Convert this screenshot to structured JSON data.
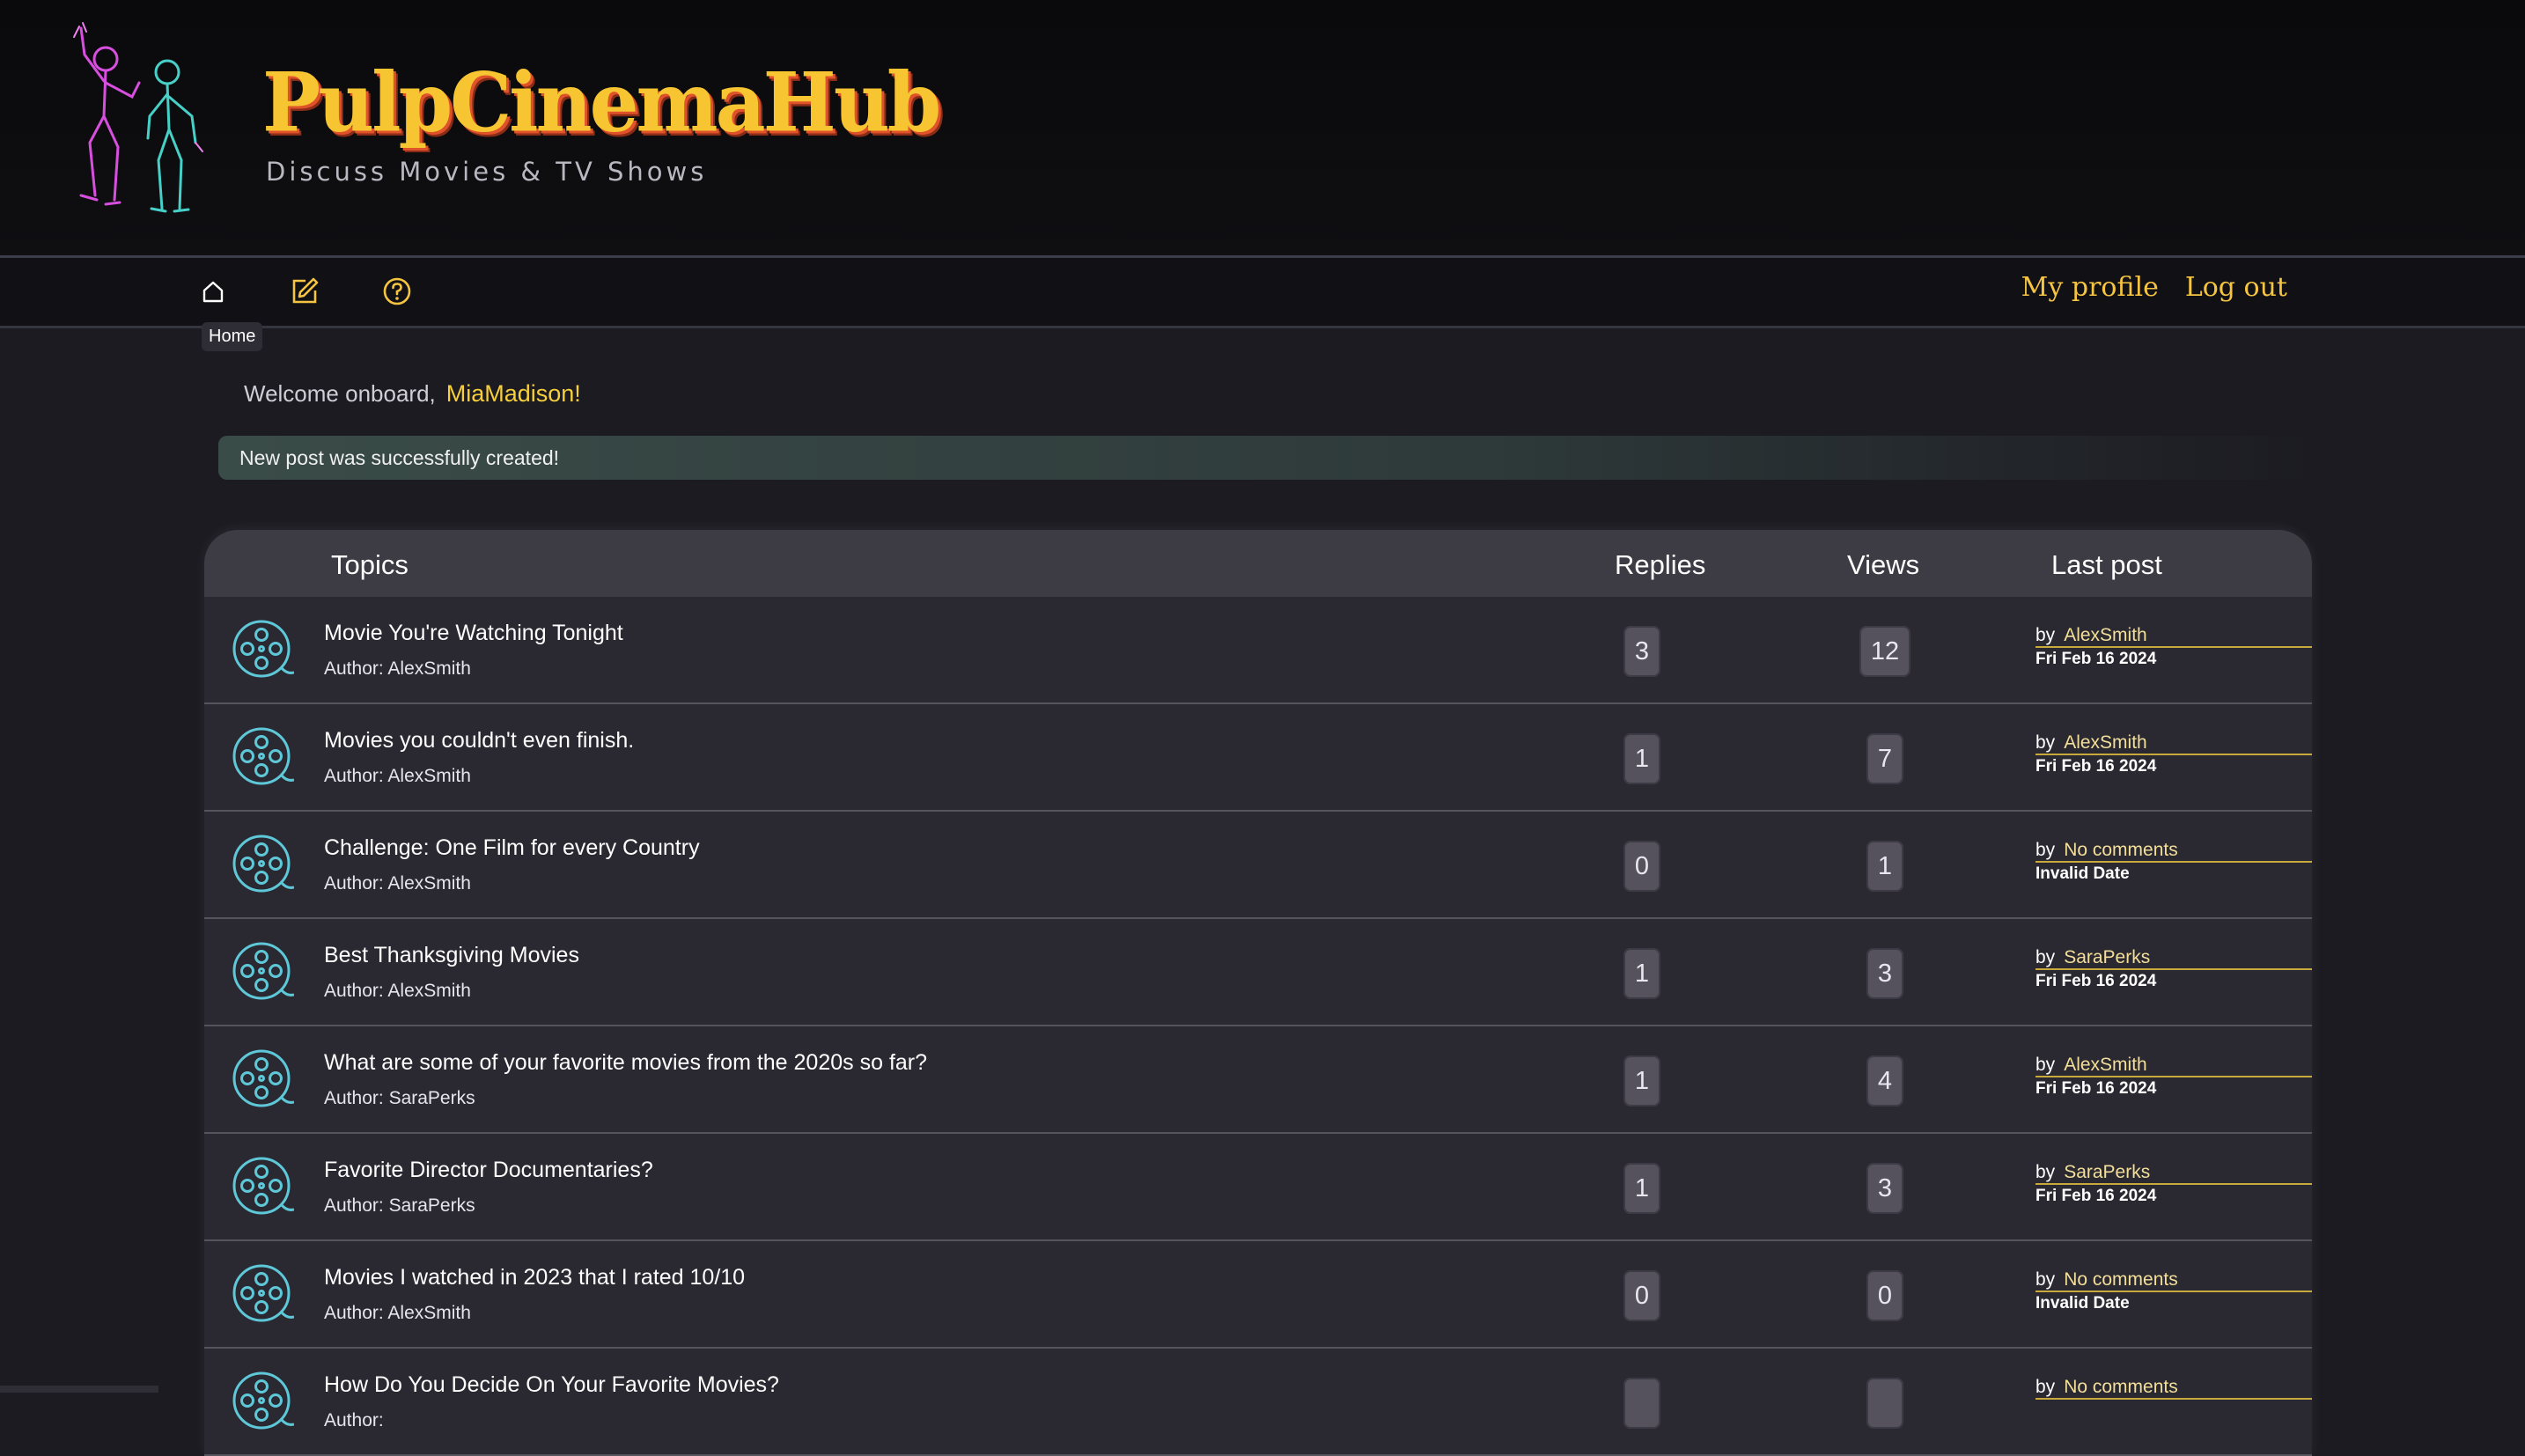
{
  "brand": {
    "title": "PulpCinemaHub",
    "tagline": "Discuss Movies & TV Shows"
  },
  "nav": {
    "icons": [
      "home-icon",
      "edit-icon",
      "help-icon"
    ],
    "tooltip": "Home",
    "my_profile": "My profile",
    "log_out": "Log out"
  },
  "welcome": {
    "text": "Welcome onboard,",
    "username": "MiaMadison!"
  },
  "flash": "New post was successfully created!",
  "table": {
    "headers": {
      "topics": "Topics",
      "replies": "Replies",
      "views": "Views",
      "last_post": "Last post"
    },
    "author_label": "Author:",
    "by_label": "by",
    "rows": [
      {
        "title": "Movie You're Watching Tonight",
        "author": "AlexSmith",
        "replies": "3",
        "views": "12",
        "last_by": "AlexSmith",
        "last_date": "Fri Feb 16 2024"
      },
      {
        "title": "Movies you couldn't even finish.",
        "author": "AlexSmith",
        "replies": "1",
        "views": "7",
        "last_by": "AlexSmith",
        "last_date": "Fri Feb 16 2024"
      },
      {
        "title": "Challenge: One Film for every Country",
        "author": "AlexSmith",
        "replies": "0",
        "views": "1",
        "last_by": "No comments",
        "last_date": "Invalid Date"
      },
      {
        "title": "Best Thanksgiving Movies",
        "author": "AlexSmith",
        "replies": "1",
        "views": "3",
        "last_by": "SaraPerks",
        "last_date": "Fri Feb 16 2024"
      },
      {
        "title": "What are some of your favorite movies from the 2020s so far?",
        "author": "SaraPerks",
        "replies": "1",
        "views": "4",
        "last_by": "AlexSmith",
        "last_date": "Fri Feb 16 2024"
      },
      {
        "title": "Favorite Director Documentaries?",
        "author": "SaraPerks",
        "replies": "1",
        "views": "3",
        "last_by": "SaraPerks",
        "last_date": "Fri Feb 16 2024"
      },
      {
        "title": "Movies I watched in 2023 that I rated 10/10",
        "author": "AlexSmith",
        "replies": "0",
        "views": "0",
        "last_by": "No comments",
        "last_date": "Invalid Date"
      },
      {
        "title": "How Do You Decide On Your Favorite Movies?",
        "author": "",
        "replies": "",
        "views": "",
        "last_by": "No comments",
        "last_date": ""
      }
    ]
  },
  "colors": {
    "accent": "#f6cf3a",
    "teal_icon": "#5ec8d8",
    "background": "#1c1b22"
  }
}
